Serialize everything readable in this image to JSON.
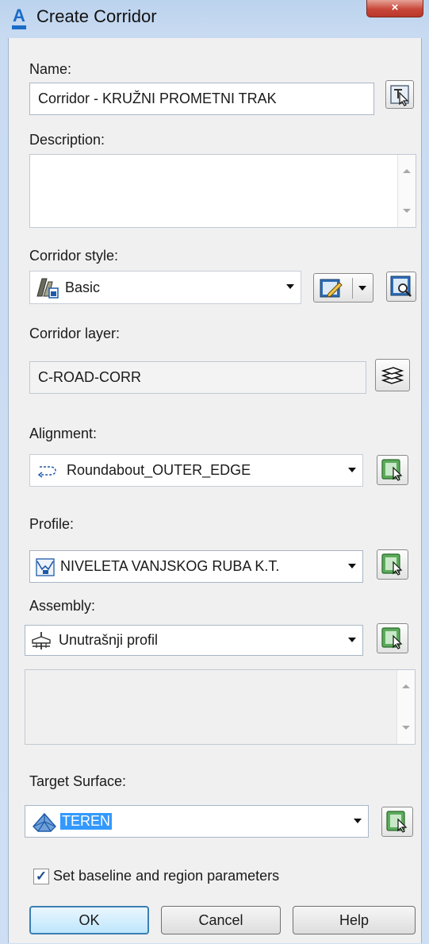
{
  "window": {
    "title": "Create Corridor",
    "close_glyph": "×"
  },
  "name": {
    "label": "Name:",
    "value": "Corridor - KRUŽNI PROMETNI TRAK"
  },
  "description": {
    "label": "Description:",
    "value": ""
  },
  "corridor_style": {
    "label": "Corridor style:",
    "value": "Basic"
  },
  "corridor_layer": {
    "label": "Corridor layer:",
    "value": "C-ROAD-CORR"
  },
  "alignment": {
    "label": "Alignment:",
    "value": "Roundabout_OUTER_EDGE"
  },
  "profile": {
    "label": "Profile:",
    "value": "NIVELETA VANJSKOG RUBA K.T."
  },
  "assembly": {
    "label": "Assembly:",
    "value": "Unutrašnji profil"
  },
  "target_surface": {
    "label": "Target Surface:",
    "value": "TEREN"
  },
  "baseline_checkbox": {
    "label": "Set baseline and region parameters",
    "checked": true,
    "mark": "✓"
  },
  "buttons": {
    "ok": "OK",
    "cancel": "Cancel",
    "help": "Help"
  },
  "icons": {
    "app": "autocad-civil-icon",
    "pick_name": "pick-from-drawing-icon",
    "style_object": "corridor-style-icon",
    "edit_style": "edit-style-icon",
    "preview_style": "preview-style-icon",
    "layer": "layer-stack-icon",
    "alignment": "alignment-icon",
    "profile": "profile-icon",
    "assembly": "assembly-icon",
    "surface": "surface-icon",
    "pick": "pick-in-drawing-icon"
  }
}
